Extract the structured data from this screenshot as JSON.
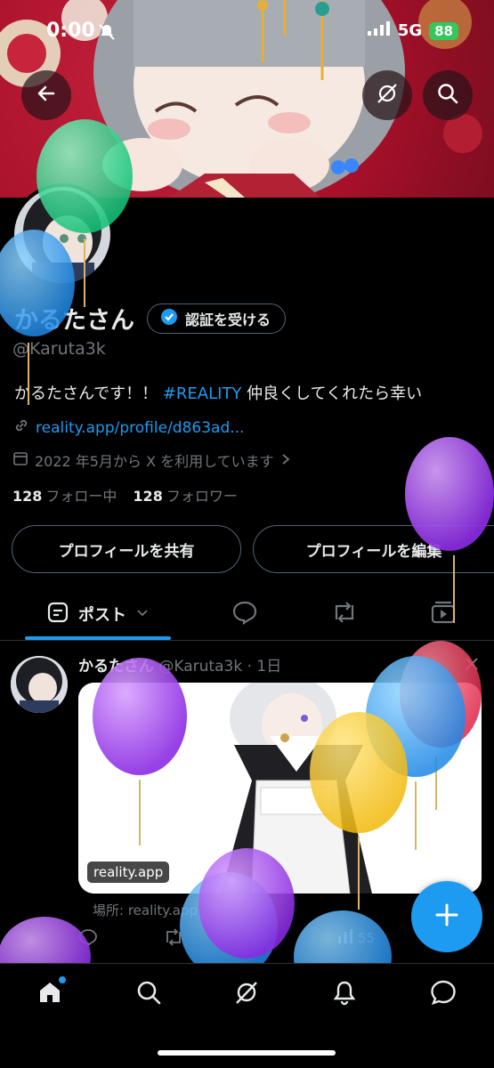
{
  "status_bar": {
    "time": "0:00",
    "network": "5G",
    "battery": "88"
  },
  "header": {
    "back_icon": "arrow-left-icon",
    "grok_icon": "grok-icon",
    "search_icon": "search-icon"
  },
  "profile": {
    "display_name": "かるたさん",
    "verify_label": "認証を受ける",
    "handle": "@Karuta3k",
    "bio_prefix": "かるたさんです！！ ",
    "bio_hashtag": "#REALITY",
    "bio_suffix": " 仲良くしてくれたら幸い",
    "link": "reality.app/profile/d863ad...",
    "joined": "2022 年5月から X を利用しています",
    "following_count": "128",
    "following_label": "フォロー中",
    "followers_count": "128",
    "followers_label": "フォロワー"
  },
  "actions": {
    "share_label": "プロフィールを共有",
    "edit_label": "プロフィールを編集"
  },
  "tabs": {
    "posts_label": "ポスト",
    "replies_icon": "speech-bubble-icon",
    "reposts_icon": "repost-icon",
    "media_icon": "video-icon"
  },
  "post": {
    "name": "かるたさん",
    "meta": " @Karuta3k · 1日",
    "card_label": "reality.app",
    "card_caption": "場所: reality.app",
    "views": "55"
  },
  "colors": {
    "accent": "#1d9bf0",
    "background": "#000000",
    "muted": "#71767b",
    "border": "#536471"
  }
}
